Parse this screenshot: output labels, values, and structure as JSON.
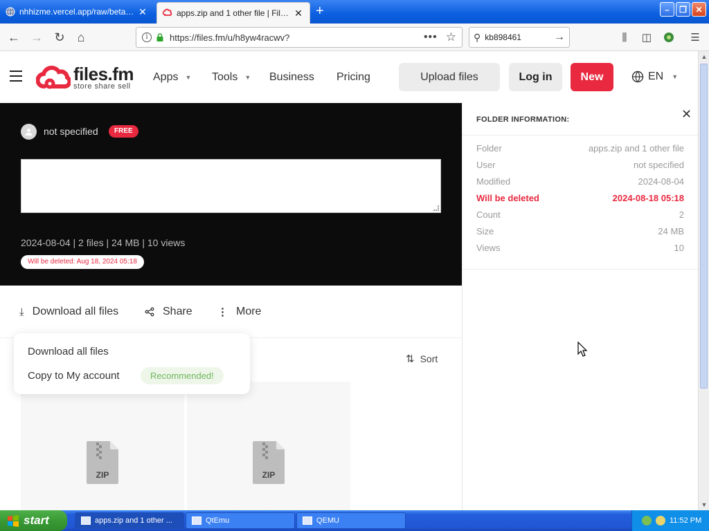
{
  "browser": {
    "tabs": [
      {
        "label": "nhhizme.vercel.app/raw/betas.txt"
      },
      {
        "label": "apps.zip and 1 other file | Files.fm"
      }
    ],
    "url": "https://files.fm/u/h8yw4racwv?",
    "search_value": "kb898461"
  },
  "header": {
    "brand": "files.fm",
    "tagline": "store share sell",
    "menu": [
      "Apps",
      "Tools",
      "Business",
      "Pricing"
    ],
    "upload_label": "Upload files",
    "login_label": "Log in",
    "new_label": "New",
    "language": "EN"
  },
  "hero": {
    "owner": "not specified",
    "plan_badge": "FREE",
    "meta": "2024-08-04 | 2 files | 24 MB | 10 views",
    "deletion_notice": "Will be deleted: Aug 18, 2024 05:18"
  },
  "actions": {
    "download_all": "Download all files",
    "share": "Share",
    "more": "More",
    "sort": "Sort"
  },
  "dropdown": {
    "items": [
      "Download all files",
      "Copy to My account"
    ],
    "recommended_badge": "Recommended!"
  },
  "files": [
    {
      "type_label": "ZIP"
    },
    {
      "type_label": "ZIP"
    }
  ],
  "folder_info": {
    "heading": "FOLDER INFORMATION:",
    "rows": [
      {
        "label": "Folder",
        "value": "apps.zip and 1 other file"
      },
      {
        "label": "User",
        "value": "not specified"
      },
      {
        "label": "Modified",
        "value": "2024-08-04"
      },
      {
        "label": "Will be deleted",
        "value": "2024-08-18 05:18"
      },
      {
        "label": "Count",
        "value": "2"
      },
      {
        "label": "Size",
        "value": "24 MB"
      },
      {
        "label": "Views",
        "value": "10"
      }
    ]
  },
  "taskbar": {
    "start_label": "start",
    "tasks": [
      "apps.zip and 1 other ...",
      "QtEmu",
      "QEMU"
    ],
    "clock": "11:52 PM"
  },
  "colors": {
    "brand_red": "#e8293f",
    "hero_bg": "#0c0c0c",
    "recommended_green": "#6db65a"
  }
}
